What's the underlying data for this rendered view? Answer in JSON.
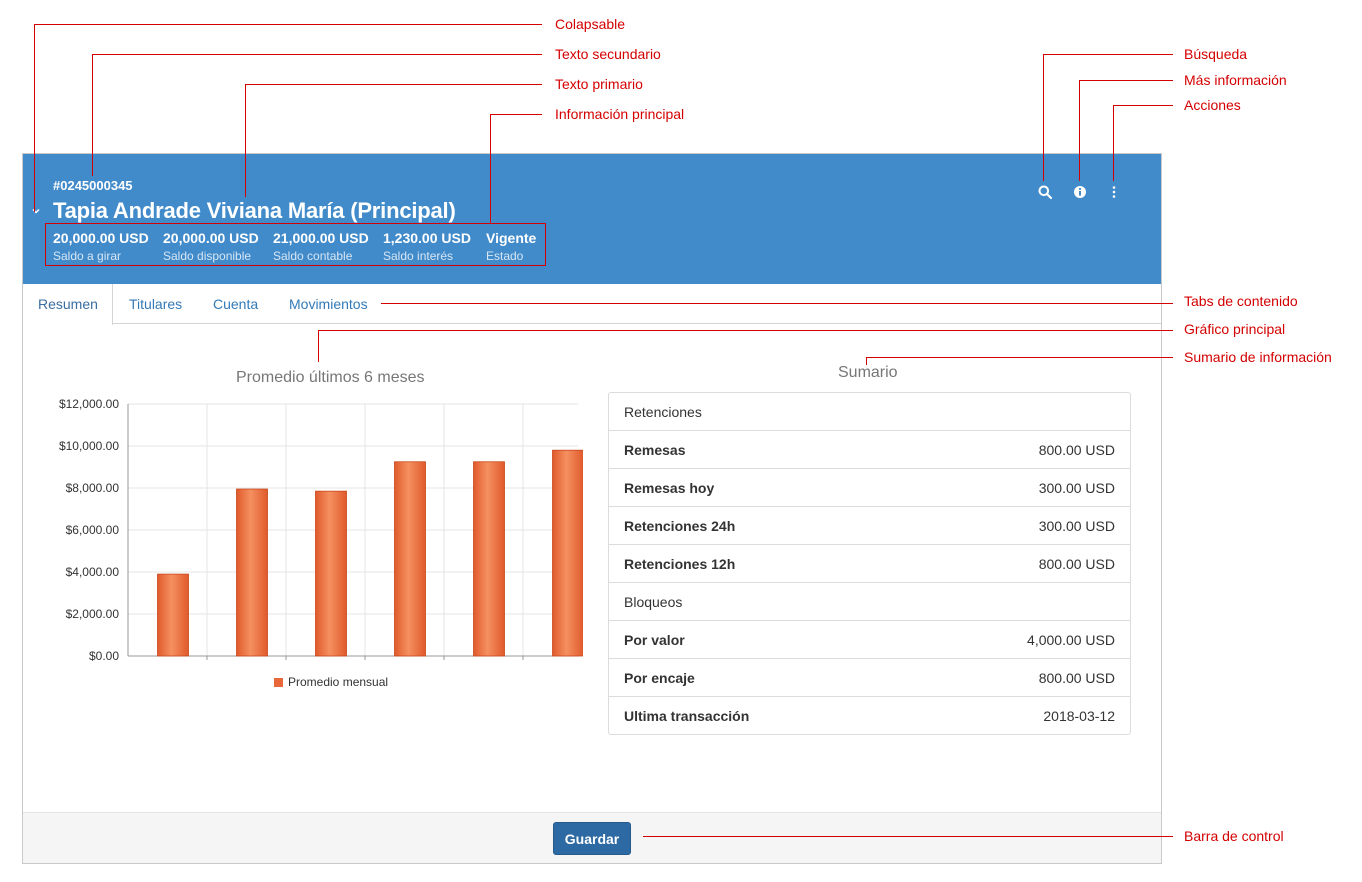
{
  "header": {
    "account_number": "#0245000345",
    "holder_name": "Tapia Andrade Viviana María (Principal)",
    "summary": [
      {
        "value": "20,000.00 USD",
        "label": "Saldo a girar"
      },
      {
        "value": "20,000.00 USD",
        "label": "Saldo disponible"
      },
      {
        "value": "21,000.00 USD",
        "label": "Saldo contable"
      },
      {
        "value": "1,230.00 USD",
        "label": "Saldo interés"
      },
      {
        "value": "Vigente",
        "label": "Estado"
      }
    ],
    "icons": [
      "chevron-down-icon",
      "search-icon",
      "info-icon",
      "more-vertical-icon"
    ],
    "background_color": "#428bca"
  },
  "tabs": [
    {
      "label": "Resumen",
      "active": true
    },
    {
      "label": "Titulares",
      "active": false
    },
    {
      "label": "Cuenta",
      "active": false
    },
    {
      "label": "Movimientos",
      "active": false
    }
  ],
  "chart_data": {
    "type": "bar",
    "title": "Promedio últimos 6 meses",
    "categories": [
      "",
      "",
      "",
      "",
      "",
      ""
    ],
    "series": [
      {
        "name": "Promedio mensual",
        "values": [
          3900,
          7950,
          7850,
          9250,
          9250,
          9800
        ],
        "color": "#e8683a"
      }
    ],
    "ylim": [
      0,
      12000
    ],
    "yticks": [
      "$0.00",
      "$2,000.00",
      "$4,000.00",
      "$6,000.00",
      "$8,000.00",
      "$10,000.00",
      "$12,000.00"
    ],
    "grid": true,
    "legend": "bottom"
  },
  "summary_panel": {
    "title": "Sumario",
    "rows": [
      {
        "label": "Retenciones",
        "value": "",
        "bold": false
      },
      {
        "label": "Remesas",
        "value": "800.00 USD",
        "bold": true
      },
      {
        "label": "Remesas hoy",
        "value": "300.00 USD",
        "bold": true
      },
      {
        "label": "Retenciones 24h",
        "value": "300.00 USD",
        "bold": true
      },
      {
        "label": "Retenciones 12h",
        "value": "800.00 USD",
        "bold": true
      },
      {
        "label": "Bloqueos",
        "value": "",
        "bold": false
      },
      {
        "label": "Por valor",
        "value": "4,000.00 USD",
        "bold": true
      },
      {
        "label": "Por encaje",
        "value": "800.00 USD",
        "bold": true
      },
      {
        "label": "Ultima transacción",
        "value": "2018-03-12",
        "bold": true
      }
    ]
  },
  "control_bar": {
    "save_label": "Guardar"
  },
  "annotations": {
    "collapsible": "Colapsable",
    "secondary_text": "Texto secundario",
    "primary_text": "Texto primario",
    "main_info": "Información principal",
    "search": "Búsqueda",
    "more_info": "Más información",
    "actions": "Acciones",
    "content_tabs": "Tabs de contenido",
    "main_chart": "Gráfico principal",
    "info_summary": "Sumario de información",
    "control_bar": "Barra de control",
    "color": "#d40000"
  }
}
